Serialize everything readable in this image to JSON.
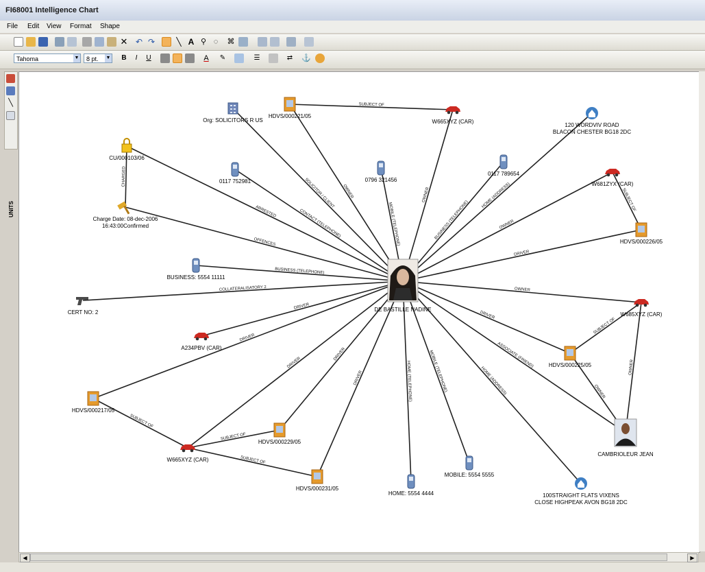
{
  "window": {
    "title": "FI68001 Intelligence Chart"
  },
  "menu": [
    "File",
    "Edit",
    "View",
    "Format",
    "Shape"
  ],
  "format_bar": {
    "font": "Tahoma",
    "size": "8 pt."
  },
  "side_tab": "UNITS",
  "colors": {
    "canvas": "#ffffff",
    "link": "#222222",
    "car": "#cc2a22",
    "case_file": "#e59a2c",
    "phone": "#6f8fbf",
    "house": "#3f7fc4"
  },
  "nodes": [
    {
      "label": "DE BASTILLE NADINE",
      "icon": "person-photo-icon"
    },
    {
      "label": "Org: SOLICITORS R US",
      "icon": "organisation-icon"
    },
    {
      "label": "HDVS/000221/05",
      "icon": "case-file-icon"
    },
    {
      "label": "W665XYZ (CAR)",
      "icon": "car-icon"
    },
    {
      "label": "120 WORDVIV ROAD BLACON CHESTER BG18 2DC",
      "icon": "house-icon"
    },
    {
      "label": "CU/000103/06",
      "icon": "padlock-icon"
    },
    {
      "label": "0117 752981",
      "icon": "phone-icon"
    },
    {
      "label": "0796 321456",
      "icon": "phone-icon"
    },
    {
      "label": "0117 789654",
      "icon": "phone-icon"
    },
    {
      "label": "W681ZYX (CAR)",
      "icon": "car-icon"
    },
    {
      "label": "Charge Date: 08-dec-2006 16:43:00Confirmed",
      "icon": "gavel-icon"
    },
    {
      "label": "HDVS/000226/05",
      "icon": "case-file-icon"
    },
    {
      "label": "BUSINESS: 5554 11111",
      "icon": "phone-icon"
    },
    {
      "label": "CERT NO: 2",
      "icon": "gun-icon"
    },
    {
      "label": "W685XYZ (CAR)",
      "icon": "car-icon"
    },
    {
      "label": "A234PBV (CAR)",
      "icon": "car-icon"
    },
    {
      "label": "HDVS/000225/05",
      "icon": "case-file-icon"
    },
    {
      "label": "HDVS/000217/05",
      "icon": "case-file-icon"
    },
    {
      "label": "HDVS/000229/05",
      "icon": "case-file-icon"
    },
    {
      "label": "W665XYZ (CAR)",
      "icon": "car-icon"
    },
    {
      "label": "CAMBRIOLEUR JEAN",
      "icon": "person-photo-icon"
    },
    {
      "label": "HDVS/000231/05",
      "icon": "case-file-icon"
    },
    {
      "label": "HOME: 5554 4444",
      "icon": "phone-icon"
    },
    {
      "label": "MOBILE: 5554 5555",
      "icon": "phone-icon"
    },
    {
      "label": "100STRAIGHT FLATS VIXENS CLOSE HIGHPEAK AVON BG18 2DC",
      "icon": "house-icon"
    }
  ],
  "links": [
    {
      "from": 2,
      "to": 3,
      "label": "SUBJECT OF"
    },
    {
      "from": 1,
      "to": 0,
      "label": "SOLICITOR / CLIENT"
    },
    {
      "from": 2,
      "to": 0,
      "label": "OWNER"
    },
    {
      "from": 3,
      "to": 0,
      "label": "OWNER"
    },
    {
      "from": 4,
      "to": 0,
      "label": "HOME (ADDRESS)"
    },
    {
      "from": 5,
      "to": 10,
      "label": "CHARGED"
    },
    {
      "from": 5,
      "to": 0,
      "label": "ARRESTED"
    },
    {
      "from": 6,
      "to": 0,
      "label": "CONTACT (TELEPHONE)"
    },
    {
      "from": 7,
      "to": 0,
      "label": "MOBILE (TELEPHONE)"
    },
    {
      "from": 8,
      "to": 0,
      "label": "BUSINESS (TELEPHONE)"
    },
    {
      "from": 9,
      "to": 11,
      "label": "SUBJECT OF"
    },
    {
      "from": 9,
      "to": 0,
      "label": "OWNER"
    },
    {
      "from": 10,
      "to": 0,
      "label": "OFFENCES"
    },
    {
      "from": 11,
      "to": 0,
      "label": "DRIVER"
    },
    {
      "from": 12,
      "to": 0,
      "label": "BUSINESS (TELEPHONE)"
    },
    {
      "from": 13,
      "to": 0,
      "label": "COLLATERALISATORY 2"
    },
    {
      "from": 14,
      "to": 0,
      "label": "OWNER"
    },
    {
      "from": 14,
      "to": 16,
      "label": "SUBJECT OF"
    },
    {
      "from": 14,
      "to": 20,
      "label": "OWNER"
    },
    {
      "from": 15,
      "to": 0,
      "label": "DRIVER"
    },
    {
      "from": 16,
      "to": 0,
      "label": "DRIVER"
    },
    {
      "from": 16,
      "to": 20,
      "label": "OWNER"
    },
    {
      "from": 17,
      "to": 0,
      "label": "DRIVER"
    },
    {
      "from": 17,
      "to": 19,
      "label": "SUBJECT OF"
    },
    {
      "from": 19,
      "to": 18,
      "label": "SUBJECT OF"
    },
    {
      "from": 19,
      "to": 21,
      "label": "SUBJECT OF"
    },
    {
      "from": 19,
      "to": 0,
      "label": "DRIVER"
    },
    {
      "from": 18,
      "to": 0,
      "label": "DRIVER"
    },
    {
      "from": 21,
      "to": 0,
      "label": "DRIVER"
    },
    {
      "from": 22,
      "to": 0,
      "label": "HOME (TELEPHONE)"
    },
    {
      "from": 23,
      "to": 0,
      "label": "MOBILE (TELEPHONE)"
    },
    {
      "from": 24,
      "to": 0,
      "label": "HOME (ADDRESS)"
    },
    {
      "from": 20,
      "to": 0,
      "label": "ASSOCIATE (FRIEND)"
    }
  ]
}
